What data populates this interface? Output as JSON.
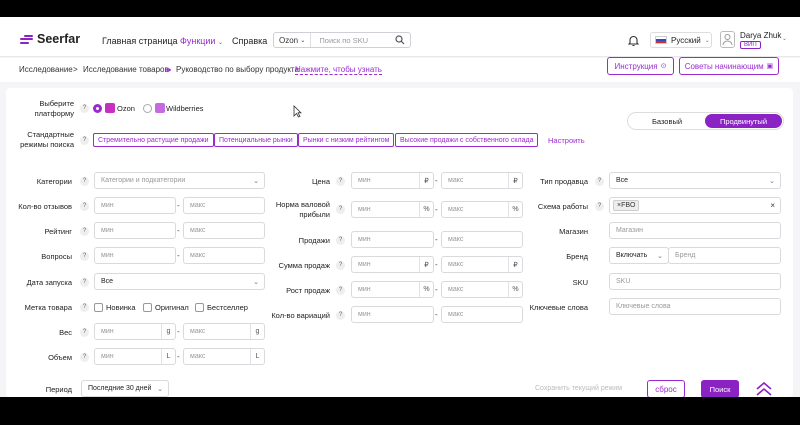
{
  "header": {
    "logo_text": "Seerfar",
    "nav": [
      "Главная страница",
      "Функции",
      "Справка"
    ],
    "search_platform": "Ozon",
    "search_placeholder": "Поиск по SKU",
    "language": "Русский",
    "user_name": "Darya Zhuk",
    "user_badge": "ВИП",
    "accent_color": "#8b22c4"
  },
  "breadcrumb": {
    "items": [
      "Исследование",
      ">",
      "Исследование товаров"
    ],
    "guide_text": "Руководство по выбору продукта",
    "guide_link": "Нажмите, чтобы узнать",
    "instruction_button": "Инструкция",
    "tips_button": "Советы начинающим"
  },
  "mode": {
    "basic": "Базовый",
    "advanced": "Продвинутый"
  },
  "platform": {
    "label": "Выберите платформу",
    "ozon": "Ozon",
    "wb": "Wildberries"
  },
  "presets": {
    "label": "Стандартные режимы поиска",
    "chips": [
      "Стремительно растущие продажи",
      "Потенциальные рынки",
      "Рынки с низким рейтингом",
      "Высокие продажи с собственного склада"
    ],
    "configure": "Настроить"
  },
  "left": {
    "category_label": "Категории",
    "category_placeholder": "Категории и подкатегории",
    "reviews_label": "Кол-во отзывов",
    "rating_label": "Рейтинг",
    "questions_label": "Вопросы",
    "launch_label": "Дата запуска",
    "launch_value": "Все",
    "mark_label": "Метка товара",
    "mark_options": [
      "Новинка",
      "Оригинал",
      "Бестселлер"
    ],
    "weight_label": "Вес",
    "weight_unit": "g",
    "volume_label": "Объем",
    "volume_unit": "L"
  },
  "middle": {
    "price_label": "Цена",
    "margin_label": "Норма валовой прибыли",
    "sales_label": "Продажи",
    "sales_sum_label": "Сумма продаж",
    "growth_label": "Рост продаж",
    "variants_label": "Кол-во вариаций",
    "currency": "₽",
    "percent": "%"
  },
  "right": {
    "seller_type_label": "Тип продавца",
    "seller_type_value": "Все",
    "scheme_label": "Схема работы",
    "scheme_tag": "FBO",
    "store_label": "Магазин",
    "store_placeholder": "Магазин",
    "brand_label": "Бренд",
    "brand_mode": "Включать",
    "brand_placeholder": "Бренд",
    "sku_label": "SKU",
    "sku_placeholder": "SKU",
    "keywords_label": "Ключевые слова",
    "keywords_placeholder": "Ключевые слова"
  },
  "footer": {
    "period_label": "Период",
    "period_value": "Последние 30 дней",
    "save_mode": "Сохранить текущий режим",
    "reset": "сброс",
    "search": "Поиск"
  },
  "common": {
    "min": "мин",
    "max": "макс",
    "dash": "-",
    "help": "?"
  }
}
